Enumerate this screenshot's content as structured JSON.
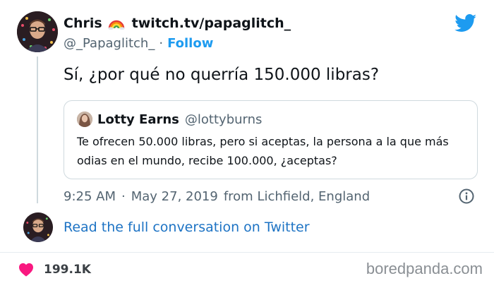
{
  "author": {
    "display_name": "Chris",
    "display_name_link": "twitch.tv/papaglitch_",
    "handle": "@_Papaglitch_",
    "separator": "·",
    "follow_label": "Follow"
  },
  "icons": {
    "rainbow": "rainbow-emoji-icon",
    "brand": "twitter-bird-icon",
    "info": "info-icon",
    "like": "heart-icon"
  },
  "colors": {
    "accent": "#1d9bf0",
    "link": "#1d73c4",
    "heart": "#f91880",
    "text": "#0f1419",
    "muted": "#536471"
  },
  "tweet": {
    "text": "Sí, ¿por qué no querría 150.000 libras?",
    "quote": {
      "name": "Lotty Earns",
      "handle": "@lottyburns",
      "text": "Te ofrecen 50.000 libras, pero si aceptas, la persona a la que más odias en el mundo, recibe 100.000, ¿aceptas?"
    },
    "time": "9:25 AM",
    "separator": "·",
    "date": "May 27, 2019",
    "location": "from Lichfield, England"
  },
  "read_conversation": "Read the full conversation on Twitter",
  "footer": {
    "likes": "199.1K",
    "watermark": "boredpanda.com"
  }
}
